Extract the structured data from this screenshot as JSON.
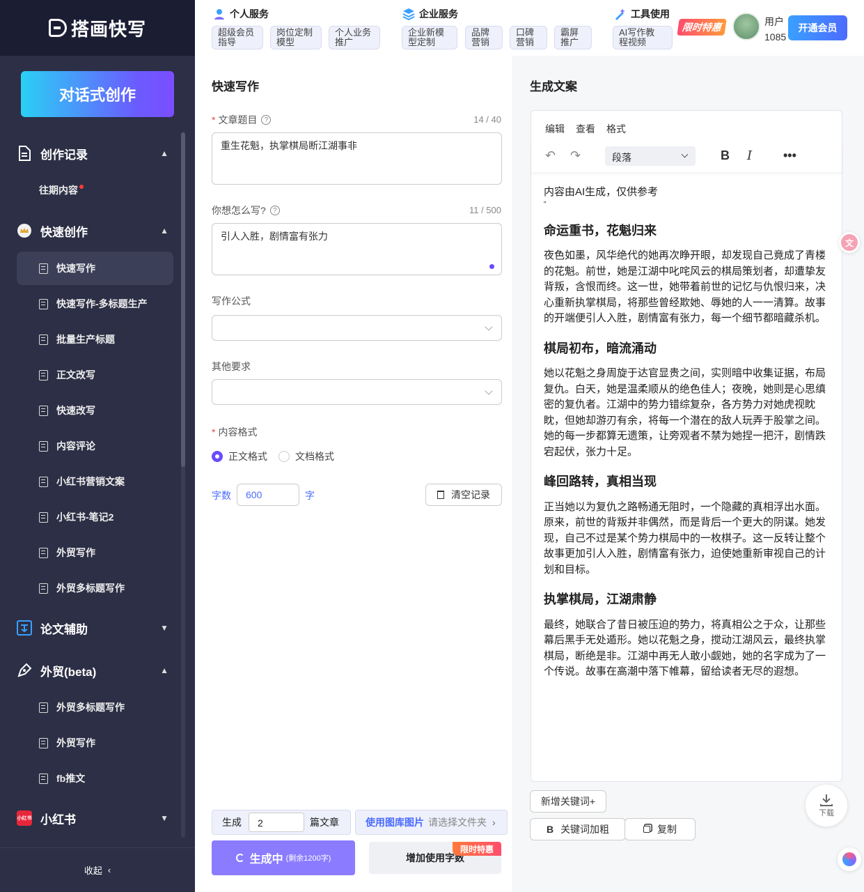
{
  "app": {
    "logo": "搭画快写",
    "chat_button": "对话式创作",
    "collapse": "收起"
  },
  "sidebar": {
    "sections": [
      {
        "label": "创作记录",
        "chevron": "▲"
      },
      {
        "label": "快速创作",
        "chevron": "▲"
      },
      {
        "label": "论文辅助",
        "chevron": "▼"
      },
      {
        "label": "外贸(beta)",
        "chevron": "▲"
      },
      {
        "label": "小红书",
        "chevron": "▼"
      }
    ],
    "history_item": "往期内容",
    "quick_items": [
      "快速写作",
      "快速写作-多标题生产",
      "批量生产标题",
      "正文改写",
      "快速改写",
      "内容评论",
      "小红书营销文案",
      "小红书-笔记2",
      "外贸写作",
      "外贸多标题写作"
    ],
    "trade_items": [
      "外贸多标题写作",
      "外贸写作",
      "fb推文"
    ],
    "xhs_icon_text": "小红书"
  },
  "topbar": {
    "groups": [
      {
        "title": "个人服务",
        "tags": [
          "超级会员\n指导",
          "岗位定制\n模型",
          "个人业务\n推广"
        ]
      },
      {
        "title": "企业服务",
        "tags": [
          "企业新模\n型定制",
          "品牌\n营销",
          "口碑\n营销",
          "霸屏\n推广"
        ]
      },
      {
        "title": "工具使用",
        "tags": [
          "AI写作教\n程视频"
        ]
      }
    ],
    "promo": "限时特惠",
    "user_name": "用户",
    "user_id": "1085",
    "vip_button": "开通会员"
  },
  "form": {
    "title": "快速写作",
    "topic_label": "文章题目",
    "topic_count": "14 / 40",
    "topic_value": "重生花魁，执掌棋局断江湖事非",
    "how_label": "你想怎么写?",
    "how_count": "11 / 500",
    "how_value": "引人入胜，剧情富有张力",
    "formula_label": "写作公式",
    "other_label": "其他要求",
    "format_label": "内容格式",
    "format_options": [
      "正文格式",
      "文档格式"
    ],
    "words_label": "字数",
    "words_value": "600",
    "words_unit": "字",
    "clear_button": "清空记录",
    "gen_prefix": "生成",
    "gen_count": "2",
    "gen_suffix": "篇文章",
    "library_label": "使用图库图片",
    "library_hint": "请选择文件夹",
    "generate_button": "生成中",
    "generate_remaining": "(剩余1200字)",
    "add_words_button": "增加使用字数",
    "add_words_badge": "限时特惠"
  },
  "output": {
    "title": "生成文案",
    "menu": [
      "编辑",
      "查看",
      "格式"
    ],
    "paragraph_select": "段落",
    "notice": "内容由AI生成，仅供参考",
    "quote_mark": "\"",
    "sections": [
      {
        "heading": "命运重书，花魁归来",
        "body": "夜色如墨，风华绝代的她再次睁开眼，却发现自己竟成了青楼的花魁。前世，她是江湖中叱咤风云的棋局策划者，却遭挚友背叛，含恨而终。这一世，她带着前世的记忆与仇恨归来，决心重新执掌棋局，将那些曾经欺她、辱她的人一一清算。故事的开端便引人入胜，剧情富有张力，每一个细节都暗藏杀机。"
      },
      {
        "heading": "棋局初布，暗流涌动",
        "body": "她以花魁之身周旋于达官显贵之间，实则暗中收集证据，布局复仇。白天，她是温柔顺从的绝色佳人；夜晚，她则是心思缜密的复仇者。江湖中的势力错综复杂，各方势力对她虎视眈眈，但她却游刃有余，将每一个潜在的敌人玩弄于股掌之间。她的每一步都算无遗策，让旁观者不禁为她捏一把汗，剧情跌宕起伏，张力十足。"
      },
      {
        "heading": "峰回路转，真相当现",
        "body": "正当她以为复仇之路畅通无阻时，一个隐藏的真相浮出水面。原来，前世的背叛并非偶然，而是背后一个更大的阴谋。她发现，自己不过是某个势力棋局中的一枚棋子。这一反转让整个故事更加引人入胜，剧情富有张力，迫使她重新审视自己的计划和目标。"
      },
      {
        "heading": "执掌棋局，江湖肃静",
        "body": "最终，她联合了昔日被压迫的势力，将真相公之于众，让那些幕后黑手无处遁形。她以花魁之身，搅动江湖风云，最终执掌棋局，断绝是非。江湖中再无人敢小觑她，她的名字成为了一个传说。故事在高潮中落下帷幕，留给读者无尽的遐想。"
      }
    ],
    "add_keyword": "新增关键词+",
    "bold_keyword": "关键词加粗",
    "copy": "复制",
    "download": "下载"
  },
  "colors": {
    "accent": "#6a4cff",
    "sidebar": "#2c2f45",
    "link": "#4a6bff"
  }
}
